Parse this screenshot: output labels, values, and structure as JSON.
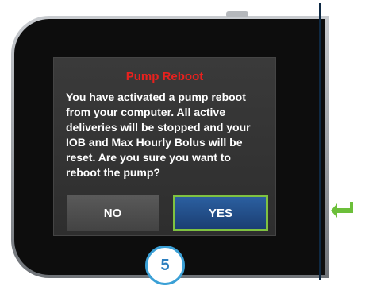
{
  "dialog": {
    "title": "Pump Reboot",
    "message": "You have activated a pump reboot from your computer. All active deliveries will be stopped and your IOB and Max Hourly Bolus will be reset. Are you sure you want to reboot the pump?",
    "no_label": "NO",
    "yes_label": "YES"
  },
  "step": {
    "number": "5"
  },
  "icons": {
    "return": "return-arrow-icon"
  },
  "colors": {
    "title_red": "#e8211e",
    "yes_blue": "#1b3f73",
    "yes_border_green": "#7fc241",
    "step_blue": "#3ba0d6",
    "return_arrow_green": "#6cbf3a"
  }
}
